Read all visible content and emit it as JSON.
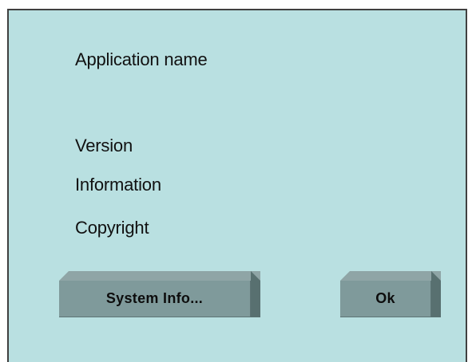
{
  "dialog": {
    "application_name": "Application name",
    "version": "Version",
    "information": "Information",
    "copyright": "Copyright"
  },
  "buttons": {
    "system_info_label": "System Info...",
    "ok_label": "Ok"
  },
  "colors": {
    "background": "#b9e0e1",
    "button_face": "#7f9a9b",
    "button_top": "#8fa5a6",
    "button_side": "#587070"
  }
}
